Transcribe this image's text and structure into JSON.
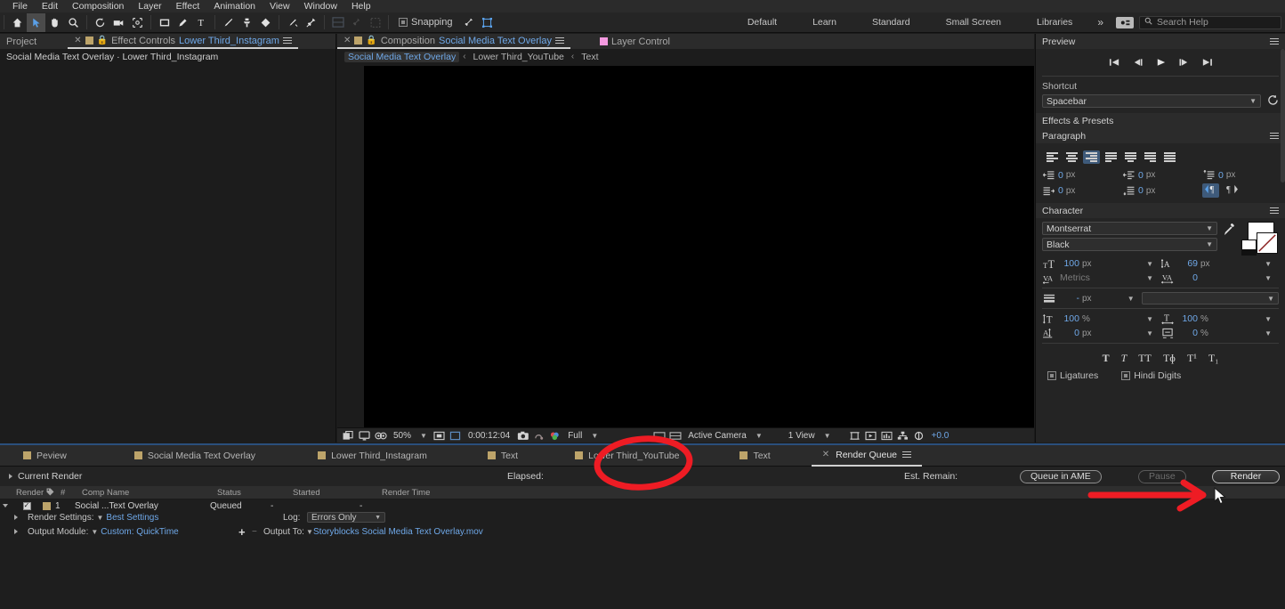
{
  "app": {
    "title": "Adobe After Effects"
  },
  "menubar": {
    "items": [
      "File",
      "Edit",
      "Composition",
      "Layer",
      "Effect",
      "Animation",
      "View",
      "Window",
      "Help"
    ]
  },
  "toolbar": {
    "tools": [
      {
        "name": "home-icon",
        "glyph": "home",
        "selected": false
      },
      {
        "name": "selection-tool-icon",
        "glyph": "arrow",
        "selected": true
      },
      {
        "name": "hand-tool-icon",
        "glyph": "hand",
        "selected": false
      },
      {
        "name": "zoom-tool-icon",
        "glyph": "magnifier",
        "selected": false
      },
      {
        "name": "rotation-tool-icon",
        "glyph": "rotate",
        "selected": false
      },
      {
        "name": "camera-tool-icon",
        "glyph": "camera",
        "selected": false
      },
      {
        "name": "pan-behind-tool-icon",
        "glyph": "anchor",
        "selected": false
      },
      {
        "name": "shape-tool-icon",
        "glyph": "rect",
        "selected": false
      },
      {
        "name": "pen-tool-icon",
        "glyph": "pen",
        "selected": false
      },
      {
        "name": "type-tool-icon",
        "glyph": "type",
        "selected": false
      },
      {
        "name": "brush-tool-icon",
        "glyph": "brush",
        "selected": false
      },
      {
        "name": "clone-stamp-tool-icon",
        "glyph": "stamp",
        "selected": false
      },
      {
        "name": "eraser-tool-icon",
        "glyph": "eraser",
        "selected": false
      },
      {
        "name": "roto-brush-tool-icon",
        "glyph": "roto",
        "selected": false
      },
      {
        "name": "puppet-pin-tool-icon",
        "glyph": "pin",
        "selected": false
      }
    ],
    "snapping_label": "Snapping",
    "snapping_checked": false
  },
  "workspaces": {
    "items": [
      "Default",
      "Learn",
      "Standard",
      "Small Screen",
      "Libraries"
    ],
    "overflow": "»",
    "search_placeholder": "Search Help"
  },
  "left_panel": {
    "project_tab": "Project",
    "effect_controls_prefix": "Effect Controls",
    "effect_controls_layer": "Lower Third_Instagram",
    "subtitle": "Social Media Text Overlay · Lower Third_Instagram"
  },
  "center_panel": {
    "composition_prefix": "Composition",
    "composition_name": "Social Media Text Overlay",
    "layer_control_tab": "Layer Control",
    "breadcrumbs": [
      "Social Media Text Overlay",
      "Lower Third_YouTube",
      "Text"
    ],
    "bottom_bar": {
      "zoom": "50%",
      "timecode": "0:00:12:04",
      "resolution": "Full",
      "view_source": "Active Camera",
      "views": "1 View",
      "exposure": "+0.0"
    }
  },
  "preview": {
    "title": "Preview",
    "shortcut_label": "Shortcut",
    "shortcut_value": "Spacebar",
    "transport": [
      "first-frame",
      "previous-frame",
      "play",
      "next-frame",
      "last-frame"
    ]
  },
  "effects_presets": {
    "title": "Effects & Presets"
  },
  "paragraph": {
    "title": "Paragraph",
    "align_buttons": [
      "align-left",
      "align-center",
      "align-right",
      "justify-last-left",
      "justify-last-center",
      "justify-last-right",
      "justify-all"
    ],
    "active_align_index": 2,
    "indent_left": "0",
    "indent_right": "0",
    "space_before": "0",
    "indent_first_line": "0",
    "space_after": "0",
    "unit": "px",
    "direction_ltr_active": true
  },
  "character": {
    "title": "Character",
    "font_family": "Montserrat",
    "font_style": "Black",
    "font_size": "100",
    "leading": "69",
    "kerning": "Metrics",
    "tracking": "0",
    "stroke_width": "-",
    "stroke_type": "",
    "vertical_scale": "100",
    "horizontal_scale": "100",
    "baseline_shift": "0",
    "tsume": "0",
    "unit_px": "px",
    "unit_pct": "%",
    "style_buttons": [
      "faux-bold",
      "faux-italic",
      "all-caps",
      "small-caps",
      "superscript",
      "subscript"
    ],
    "ligatures_label": "Ligatures",
    "hindi_digits_label": "Hindi Digits"
  },
  "bottom_tabs": [
    {
      "label": "Peview",
      "active": false
    },
    {
      "label": "Social Media Text Overlay",
      "active": false
    },
    {
      "label": "Lower Third_Instagram",
      "active": false
    },
    {
      "label": "Text",
      "active": false
    },
    {
      "label": "Lower Third_YouTube",
      "active": false
    },
    {
      "label": "Text",
      "active": false
    },
    {
      "label": "Render Queue",
      "active": true
    }
  ],
  "render_queue": {
    "current_render_label": "Current Render",
    "elapsed_label": "Elapsed:",
    "est_remain_label": "Est. Remain:",
    "queue_in_ame_label": "Queue in AME",
    "pause_label": "Pause",
    "render_label": "Render",
    "columns": [
      "Render",
      "tag",
      "#",
      "",
      "Comp Name",
      "Status",
      "Started",
      "Render Time"
    ],
    "rows": [
      {
        "checked": true,
        "index": "1",
        "comp_name": "Social ...Text Overlay",
        "status": "Queued",
        "started": "-",
        "render_time": "-",
        "render_settings_label": "Render Settings:",
        "render_settings_value": "Best Settings",
        "log_label": "Log:",
        "log_value": "Errors Only",
        "output_module_label": "Output Module:",
        "output_module_value": "Custom: QuickTime",
        "output_to_label": "Output To:",
        "output_to_value": "Storyblocks Social Media Text Overlay.mov"
      }
    ]
  },
  "annotations": {
    "color": "#ee1c24",
    "circle_target": "render-queue-tab",
    "arrow_target": "render-button"
  },
  "colors": {
    "accent_blue": "#6fa8e8",
    "panel_bg": "#1c1c1c",
    "tab_bg": "#2b2b2b",
    "annotation_red": "#ee1c24",
    "layer_tab_pink": "#f49ae0",
    "comp_tab_tan": "#bda46a"
  }
}
